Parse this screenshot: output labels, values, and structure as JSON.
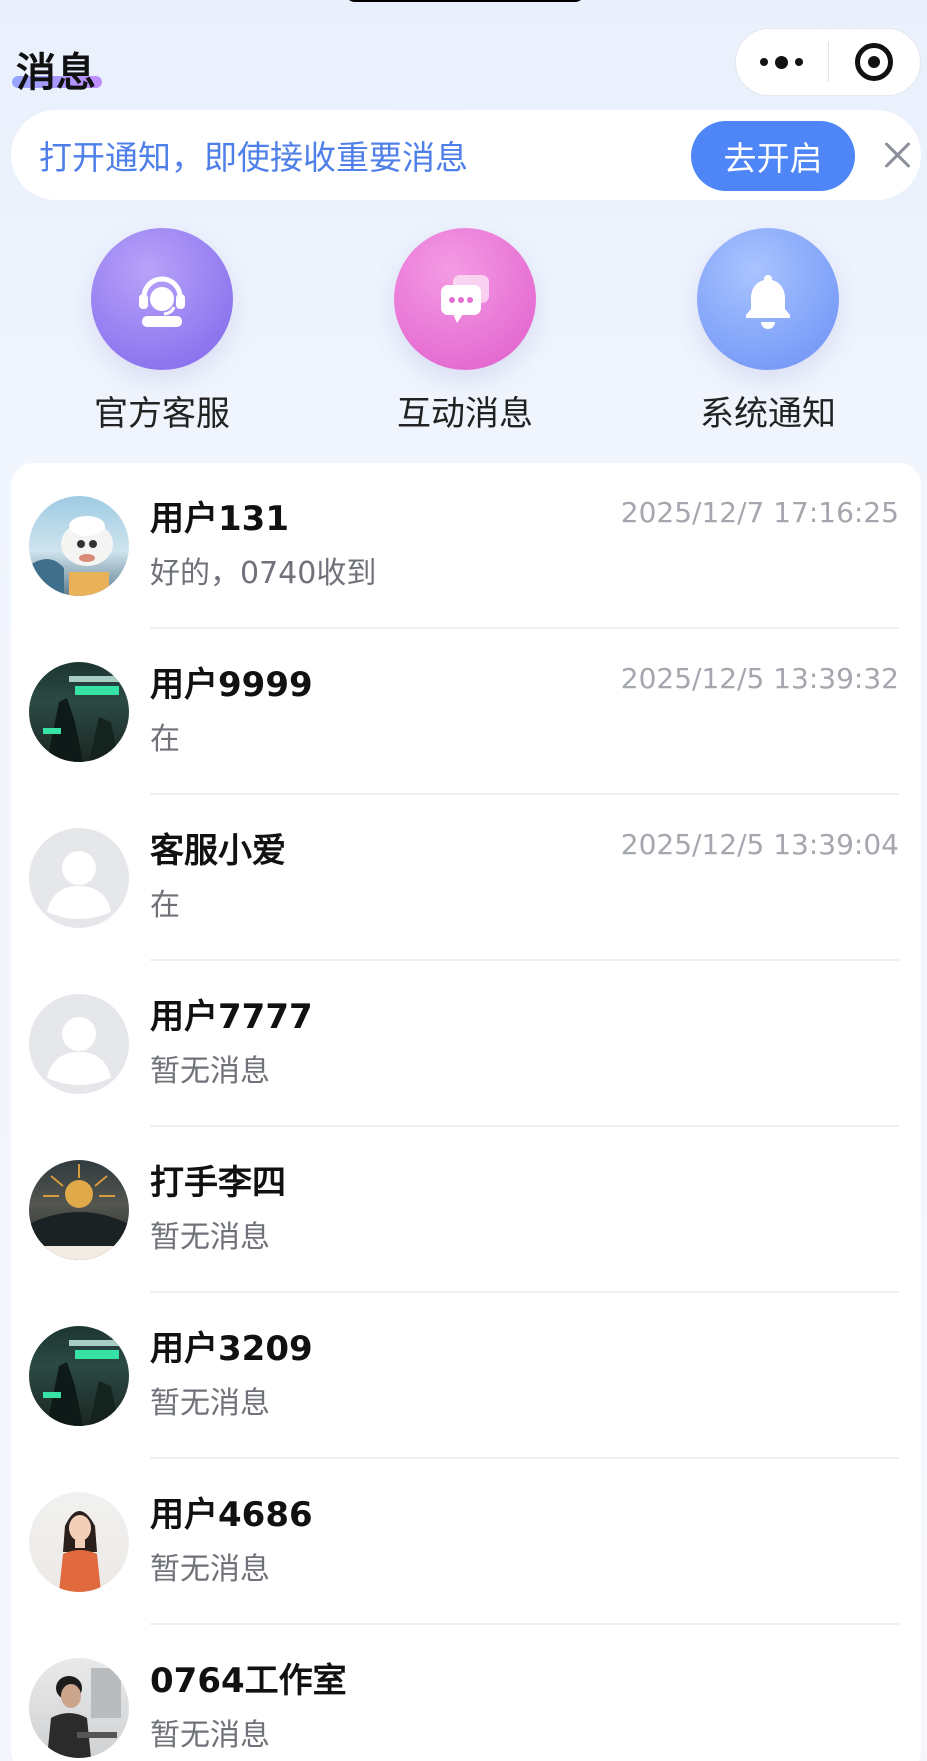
{
  "header": {
    "title": "消息"
  },
  "notice": {
    "text": "打开通知，即使接收重要消息",
    "button_label": "去开启"
  },
  "quick_actions": [
    {
      "label": "官方客服",
      "icon": "customer-service-icon",
      "color": "#8f78ef"
    },
    {
      "label": "互动消息",
      "icon": "chat-bubbles-icon",
      "color": "#e66fd3"
    },
    {
      "label": "系统通知",
      "icon": "bell-icon",
      "color": "#7d9ff8"
    }
  ],
  "conversations": [
    {
      "name": "用户131",
      "time": "2025/12/7 17:16:25",
      "preview": "好的，0740收到",
      "avatar": "cartoon-sheep-avatar"
    },
    {
      "name": "用户9999",
      "time": "2025/12/5 13:39:32",
      "preview": "在",
      "avatar": "game-poster-avatar"
    },
    {
      "name": "客服小爱",
      "time": "2025/12/5 13:39:04",
      "preview": "在",
      "avatar": "default-avatar"
    },
    {
      "name": "用户7777",
      "time": "",
      "preview": "暂无消息",
      "avatar": "default-avatar"
    },
    {
      "name": "打手李四",
      "time": "",
      "preview": "暂无消息",
      "avatar": "game-sunburst-avatar"
    },
    {
      "name": "用户3209",
      "time": "",
      "preview": "暂无消息",
      "avatar": "game-poster-avatar"
    },
    {
      "name": "用户4686",
      "time": "",
      "preview": "暂无消息",
      "avatar": "woman-photo-avatar"
    },
    {
      "name": "0764工作室",
      "time": "",
      "preview": "暂无消息",
      "avatar": "man-at-desk-avatar"
    }
  ],
  "colors": {
    "accent": "#4f86f7",
    "notice_text": "#4f7fe8",
    "timestamp": "#a4a7ad"
  }
}
